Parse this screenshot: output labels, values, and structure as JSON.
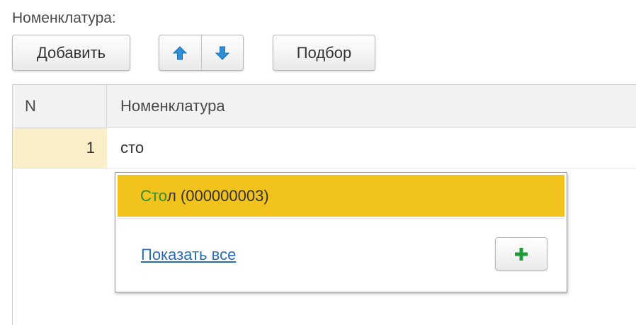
{
  "section": {
    "title": "Номенклатура:"
  },
  "toolbar": {
    "add_label": "Добавить",
    "move_up_icon": "arrow-up-icon",
    "move_down_icon": "arrow-down-icon",
    "pick_label": "Подбор"
  },
  "table": {
    "columns": [
      "N",
      "Номенклатура"
    ],
    "rows": [
      {
        "n": "1",
        "name": "сто"
      }
    ]
  },
  "autocomplete": {
    "suggestion": {
      "match": "Сто",
      "rest": "л (000000003)"
    },
    "show_all_label": "Показать все",
    "create_icon": "plus-icon"
  },
  "colors": {
    "highlight": "#f1c31c",
    "current_cell": "#f8efc8",
    "match_text": "#2f8f2f",
    "link": "#2a6db3",
    "arrow": "#2d8fd8",
    "plus": "#1f9a3a"
  }
}
